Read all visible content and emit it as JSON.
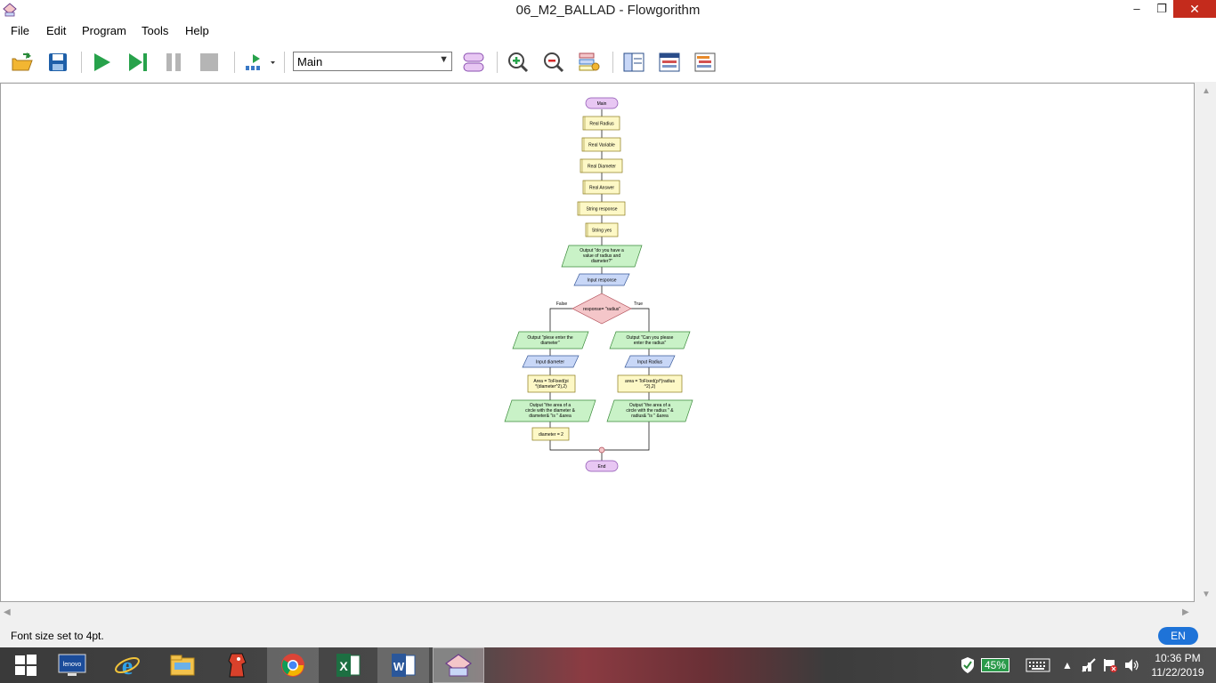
{
  "window": {
    "title": "06_M2_BALLAD - Flowgorithm",
    "minimize_label": "–",
    "restore_label": "❐",
    "close_label": "✕"
  },
  "menu": {
    "items": [
      {
        "label": "File"
      },
      {
        "label": "Edit"
      },
      {
        "label": "Program"
      },
      {
        "label": "Tools"
      },
      {
        "label": "Help"
      }
    ]
  },
  "toolbar": {
    "function_select": {
      "value": "Main"
    },
    "icons": [
      "open-folder-icon",
      "save-icon",
      "run-icon",
      "step-icon",
      "pause-icon",
      "stop-icon",
      "run-speed-icon",
      "layout-icon",
      "zoom-in-icon",
      "zoom-out-icon",
      "colors-icon",
      "variable-watch-icon",
      "console-icon",
      "source-code-icon"
    ]
  },
  "flowchart": {
    "start": "Main",
    "declarations": [
      "Real Radius",
      "Real Variable",
      "Real Diameter",
      "Real Answer",
      "String response",
      "String yes"
    ],
    "output_prompt": [
      "Output \"do you have a",
      "value of radius and",
      "diameter?\""
    ],
    "input_response": "Input response",
    "decision": "response= \"radius\"",
    "false_label": "False",
    "true_label": "True",
    "false_branch": {
      "output": [
        "Output \"plese enter the",
        "diameter\""
      ],
      "input": "Input diameter",
      "assign": [
        "Area = ToFixed(pi",
        "*(diameter^2),2)"
      ],
      "output_result": [
        "Output \"the area of a",
        "circle with the diameter &",
        "diameter& \"is \" &area"
      ],
      "assign2": "diameter = 2"
    },
    "true_branch": {
      "output": [
        "Output \"Can you please",
        "enter the radius\""
      ],
      "input": "Input Radius",
      "assign": [
        "area = ToFixed(pi*(radius",
        "^2),2)"
      ],
      "output_result": [
        "Output \"the area of a",
        "circle with the radius \" &",
        "radius& \"is \" &area"
      ]
    },
    "end": "End"
  },
  "status": {
    "message": "Font size set to 4pt.",
    "language": "EN"
  },
  "taskbar": {
    "apps": [
      "windows-start-icon",
      "lenovo-icon",
      "internet-explorer-icon",
      "file-explorer-icon",
      "flowgorithm-red-icon",
      "chrome-icon",
      "excel-icon",
      "word-icon",
      "flowgorithm-icon"
    ],
    "battery": "45%",
    "time": "10:36 PM",
    "date": "11/22/2019"
  },
  "colors": {
    "terminal": "#e8c7f3",
    "declare": "#fdf8c6",
    "output": "#c9f2c7",
    "input": "#c8d7f7",
    "decision": "#f4c6c9",
    "close_button": "#c42b1c",
    "language_badge": "#1e73d8"
  }
}
